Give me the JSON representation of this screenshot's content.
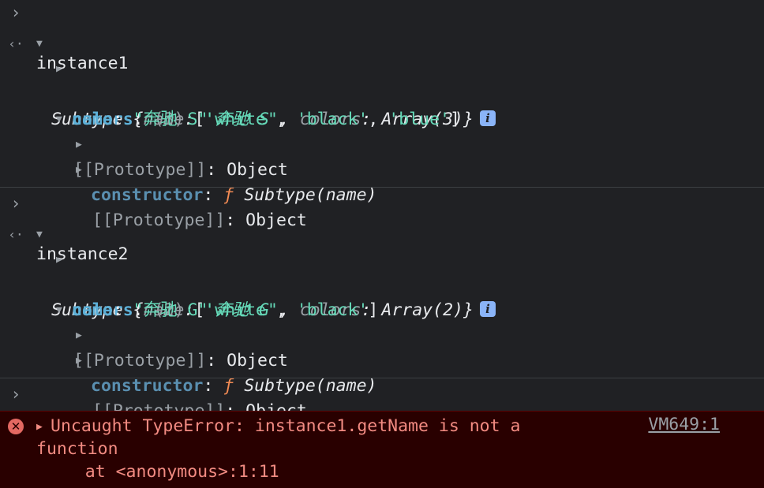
{
  "colors": {
    "background": "#202124",
    "error_bg": "#290000",
    "error_text": "#f28b82",
    "prop_blue": "#5db0d7",
    "string_teal": "#65d9b8",
    "function_orange": "#f28b54",
    "method_yellow": "#e5c07b"
  },
  "icons": {
    "prompt": "chevron-right-icon",
    "result": "return-arrow-icon",
    "expanded": "triangle-down-icon",
    "collapsed": "triangle-right-icon",
    "info": "info-icon",
    "error": "error-circle-icon"
  },
  "entries": [
    {
      "command": "instance1",
      "summary": {
        "type": "Subtype",
        "open": " {",
        "name_key": "name",
        "colon": ": ",
        "name_val": "'奔驰 S'",
        "comma": ", ",
        "colors_key": "colors",
        "colors_val": "Array(3)",
        "close": "}"
      },
      "colors_prop": {
        "key": "colors",
        "count": "(3)",
        "items": [
          "'white'",
          "'black'",
          "'blue'"
        ]
      },
      "name_prop": {
        "key": "name",
        "value": "\"奔驰 S\""
      },
      "prototype": {
        "key": "[[Prototype]]",
        "value": "Object",
        "constructor": {
          "key": "constructor",
          "f": "ƒ",
          "value": "Subtype(name)"
        },
        "inner": {
          "key": "[[Prototype]]",
          "value": "Object"
        }
      }
    },
    {
      "command": "instance2",
      "summary": {
        "type": "Subtype",
        "open": " {",
        "name_key": "name",
        "colon": ": ",
        "name_val": "'奔驰 G'",
        "comma": ", ",
        "colors_key": "colors",
        "colors_val": "Array(2)",
        "close": "}"
      },
      "colors_prop": {
        "key": "colors",
        "count": "(2)",
        "items": [
          "'white'",
          "'black'"
        ]
      },
      "name_prop": {
        "key": "name",
        "value": "\"奔驰 G\""
      },
      "prototype": {
        "key": "[[Prototype]]",
        "value": "Object",
        "constructor": {
          "key": "constructor",
          "f": "ƒ",
          "value": "Subtype(name)"
        },
        "inner": {
          "key": "[[Prototype]]",
          "value": "Object"
        }
      }
    }
  ],
  "call": {
    "object": "instance1",
    "dot": ".",
    "method": "getName",
    "parens": "()"
  },
  "error": {
    "message_line1": "Uncaught TypeError: instance1.getName is not a",
    "message_line2": "function",
    "stack": "    at <anonymous>:1:11",
    "source": "VM649:1"
  },
  "glyphs": {
    "prompt": "›",
    "result": "‹·",
    "down": "▼",
    "right": "▶",
    "info": "i",
    "error": "✕"
  }
}
